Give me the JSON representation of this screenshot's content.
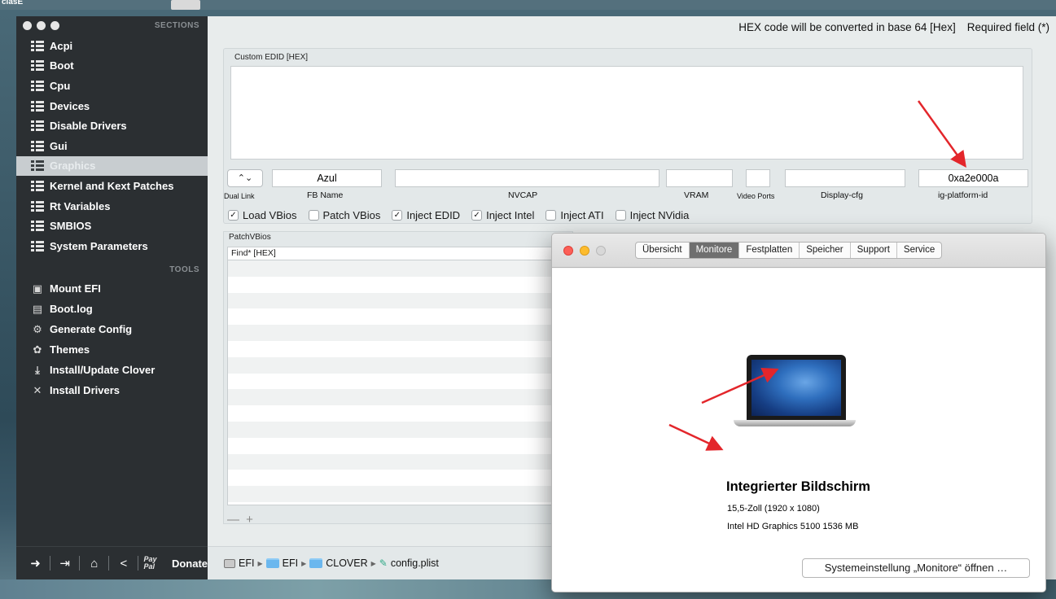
{
  "desktop": {
    "corner_text": "ciasE"
  },
  "sidebar": {
    "sections_header": "SECTIONS",
    "items": [
      {
        "label": "Acpi"
      },
      {
        "label": "Boot"
      },
      {
        "label": "Cpu"
      },
      {
        "label": "Devices"
      },
      {
        "label": "Disable Drivers"
      },
      {
        "label": "Gui"
      },
      {
        "label": "Graphics",
        "active": true
      },
      {
        "label": "Kernel and Kext Patches"
      },
      {
        "label": "Rt Variables"
      },
      {
        "label": "SMBIOS"
      },
      {
        "label": "System Parameters"
      }
    ],
    "tools_header": "TOOLS",
    "tools": [
      {
        "label": "Mount EFI",
        "icon": "drive-icon"
      },
      {
        "label": "Boot.log",
        "icon": "log-icon"
      },
      {
        "label": "Generate Config",
        "icon": "gears-icon"
      },
      {
        "label": "Themes",
        "icon": "palette-icon"
      },
      {
        "label": "Install/Update Clover",
        "icon": "download-icon"
      },
      {
        "label": "Install Drivers",
        "icon": "wrench-icon"
      }
    ],
    "footer": {
      "paypal": "Pay Pal",
      "donate": "Donate"
    }
  },
  "content": {
    "hex_note": "HEX code will be converted in base 64 [Hex]",
    "required_note": "Required field (*)",
    "custom_edid_label": "Custom EDID [HEX]",
    "custom_edid_value": "",
    "fields": {
      "dual_link": {
        "label": "Dual Link",
        "value": ""
      },
      "fb_name": {
        "label": "FB Name",
        "value": "Azul"
      },
      "nvcap": {
        "label": "NVCAP",
        "value": ""
      },
      "vram": {
        "label": "VRAM",
        "value": ""
      },
      "video_ports": {
        "label": "Video Ports",
        "value": ""
      },
      "display_cfg": {
        "label": "Display-cfg",
        "value": ""
      },
      "ig_platform_id": {
        "label": "ig-platform-id",
        "value": "0xa2e000a"
      }
    },
    "checkboxes": [
      {
        "label": "Load VBios",
        "checked": true
      },
      {
        "label": "Patch VBios",
        "checked": false
      },
      {
        "label": "Inject EDID",
        "checked": true
      },
      {
        "label": "Inject Intel",
        "checked": true
      },
      {
        "label": "Inject ATI",
        "checked": false
      },
      {
        "label": "Inject NVidia",
        "checked": false
      }
    ],
    "patch_vbios": {
      "label": "PatchVBios",
      "column": "Find* [HEX]",
      "controls": "— +"
    },
    "path_bar": [
      "EFI",
      "EFI",
      "CLOVER",
      "config.plist"
    ]
  },
  "sysinfo": {
    "tabs": [
      {
        "label": "Übersicht"
      },
      {
        "label": "Monitore",
        "active": true
      },
      {
        "label": "Festplatten"
      },
      {
        "label": "Speicher"
      },
      {
        "label": "Support"
      },
      {
        "label": "Service"
      }
    ],
    "display_title": "Integrierter Bildschirm",
    "display_size": "15,5-Zoll (1920 x 1080)",
    "display_gpu": "Intel HD Graphics 5100 1536 MB",
    "open_prefs_button": "Systemeinstellung „Monitore“ öffnen …"
  },
  "colors": {
    "sidebar_bg": "#2b2f32",
    "content_bg": "#e8ecec",
    "annotation_arrow": "#e3262b"
  }
}
